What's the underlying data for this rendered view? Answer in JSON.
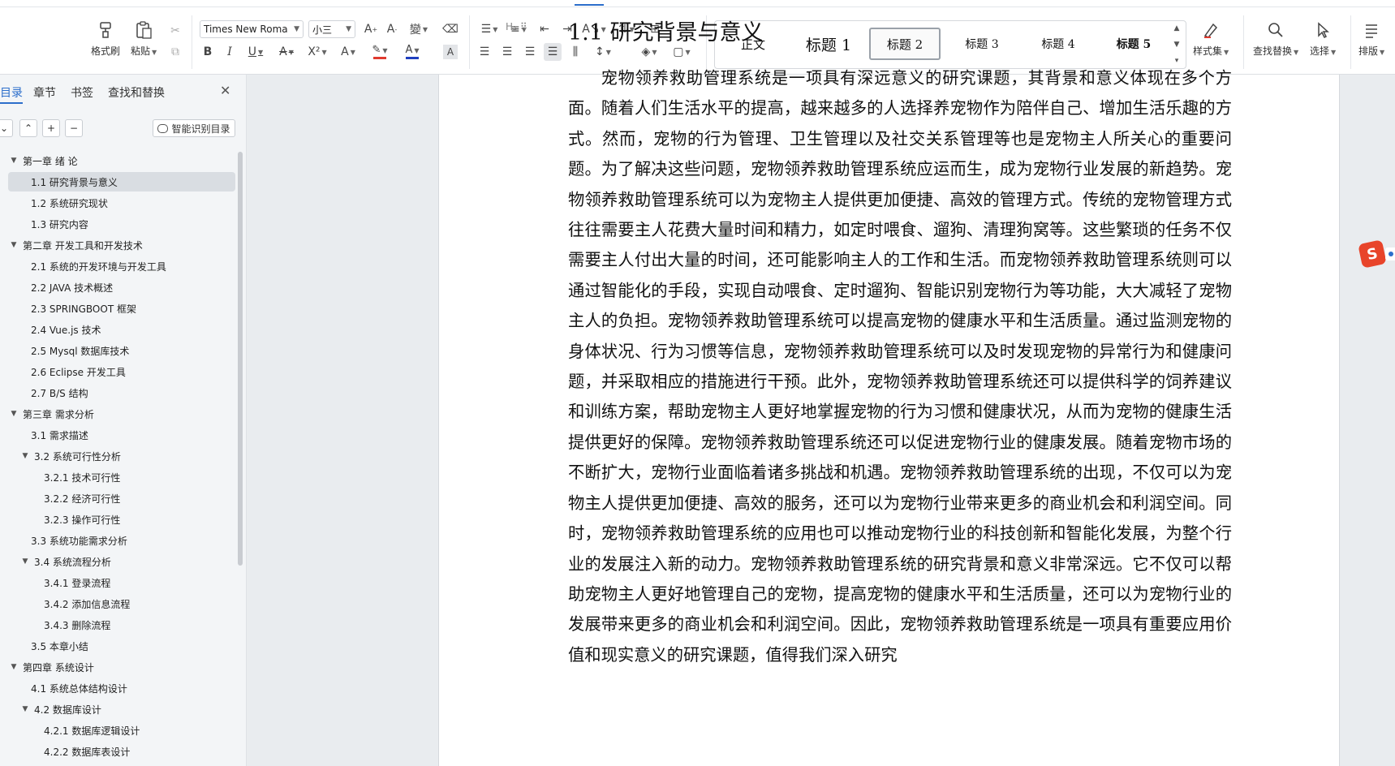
{
  "ribbon": {
    "clipboard": {
      "format_painter": "格式刷",
      "paste": "粘贴"
    },
    "font": {
      "family": "Times New Roma",
      "size": "小三"
    },
    "styles": [
      "正文",
      "标题 1",
      "标题 2",
      "标题 3",
      "标题 4",
      "标题 5"
    ],
    "selected_style": "标题 2",
    "styleset": "样式集",
    "find_replace": "查找替换",
    "select": "选择",
    "layout": "排版"
  },
  "nav": {
    "tabs": [
      "目录",
      "章节",
      "书签",
      "查找和替换"
    ],
    "active_tab": "目录",
    "smart_toc": "智能识别目录",
    "toc": [
      {
        "label": "第一章 绪  论",
        "level": 1,
        "expanded": true
      },
      {
        "label": "1.1 研究背景与意义",
        "level": 2,
        "selected": true
      },
      {
        "label": "1.2 系统研究现状",
        "level": 2
      },
      {
        "label": "1.3  研究内容",
        "level": 2
      },
      {
        "label": "第二章  开发工具和开发技术",
        "level": 1,
        "expanded": true
      },
      {
        "label": "2.1 系统的开发环境与开发工具",
        "level": 2
      },
      {
        "label": "2.2 JAVA 技术概述",
        "level": 2
      },
      {
        "label": "2.3 SPRINGBOOT  框架",
        "level": 2
      },
      {
        "label": "2.4 Vue.js 技术",
        "level": 2
      },
      {
        "label": "2.5 Mysql 数据库技术",
        "level": 2
      },
      {
        "label": "2.6 Eclipse 开发工具",
        "level": 2
      },
      {
        "label": "2.7 B/S 结构",
        "level": 2
      },
      {
        "label": "第三章  需求分析",
        "level": 1,
        "expanded": true
      },
      {
        "label": "3.1  需求描述",
        "level": 2
      },
      {
        "label": "3.2  系统可行性分析",
        "level": 2,
        "expanded": true
      },
      {
        "label": "3.2.1 技术可行性",
        "level": 3
      },
      {
        "label": "3.2.2  经济可行性",
        "level": 3
      },
      {
        "label": "3.2.3  操作可行性",
        "level": 3
      },
      {
        "label": "3.3  系统功能需求分析",
        "level": 2
      },
      {
        "label": "3.4  系统流程分析",
        "level": 2,
        "expanded": true
      },
      {
        "label": "3.4.1  登录流程",
        "level": 3
      },
      {
        "label": "3.4.2  添加信息流程",
        "level": 3
      },
      {
        "label": "3.4.3  删除流程",
        "level": 3
      },
      {
        "label": "3.5  本章小结",
        "level": 2
      },
      {
        "label": "第四章  系统设计",
        "level": 1,
        "expanded": true
      },
      {
        "label": "4.1  系统总体结构设计",
        "level": 2
      },
      {
        "label": "4.2  数据库设计",
        "level": 2,
        "expanded": true
      },
      {
        "label": "4.2.1  数据库逻辑设计",
        "level": 3
      },
      {
        "label": "4.2.2  数据库表设计",
        "level": 3
      }
    ]
  },
  "document": {
    "heading_marker": "H₂",
    "heading": "1.1 研究背景与意义",
    "paragraph": "宠物领养救助管理系统是一项具有深远意义的研究课题，其背景和意义体现在多个方面。随着人们生活水平的提高，越来越多的人选择养宠物作为陪伴自己、增加生活乐趣的方式。然而，宠物的行为管理、卫生管理以及社交关系管理等也是宠物主人所关心的重要问题。为了解决这些问题，宠物领养救助管理系统应运而生，成为宠物行业发展的新趋势。宠物领养救助管理系统可以为宠物主人提供更加便捷、高效的管理方式。传统的宠物管理方式往往需要主人花费大量时间和精力，如定时喂食、遛狗、清理狗窝等。这些繁琐的任务不仅需要主人付出大量的时间，还可能影响主人的工作和生活。而宠物领养救助管理系统则可以通过智能化的手段，实现自动喂食、定时遛狗、智能识别宠物行为等功能，大大减轻了宠物主人的负担。宠物领养救助管理系统可以提高宠物的健康水平和生活质量。通过监测宠物的身体状况、行为习惯等信息，宠物领养救助管理系统可以及时发现宠物的异常行为和健康问题，并采取相应的措施进行干预。此外，宠物领养救助管理系统还可以提供科学的饲养建议和训练方案，帮助宠物主人更好地掌握宠物的行为习惯和健康状况，从而为宠物的健康生活提供更好的保障。宠物领养救助管理系统还可以促进宠物行业的健康发展。随着宠物市场的不断扩大，宠物行业面临着诸多挑战和机遇。宠物领养救助管理系统的出现，不仅可以为宠物主人提供更加便捷、高效的服务，还可以为宠物行业带来更多的商业机会和利润空间。同时，宠物领养救助管理系统的应用也可以推动宠物行业的科技创新和智能化发展，为整个行业的发展注入新的动力。宠物领养救助管理系统的研究背景和意义非常深远。它不仅可以帮助宠物主人更好地管理自己的宠物，提高宠物的健康水平和生活质量，还可以为宠物行业的发展带来更多的商业机会和利润空间。因此，宠物领养救助管理系统是一项具有重要应用价值和现实意义的研究课题，值得我们深入研究"
  },
  "colors": {
    "accent": "#2c6ecb",
    "font_color_bar": "#1f3fbf",
    "highlight_bar": "#e03a2f",
    "ime_logo": "#e8442a"
  }
}
